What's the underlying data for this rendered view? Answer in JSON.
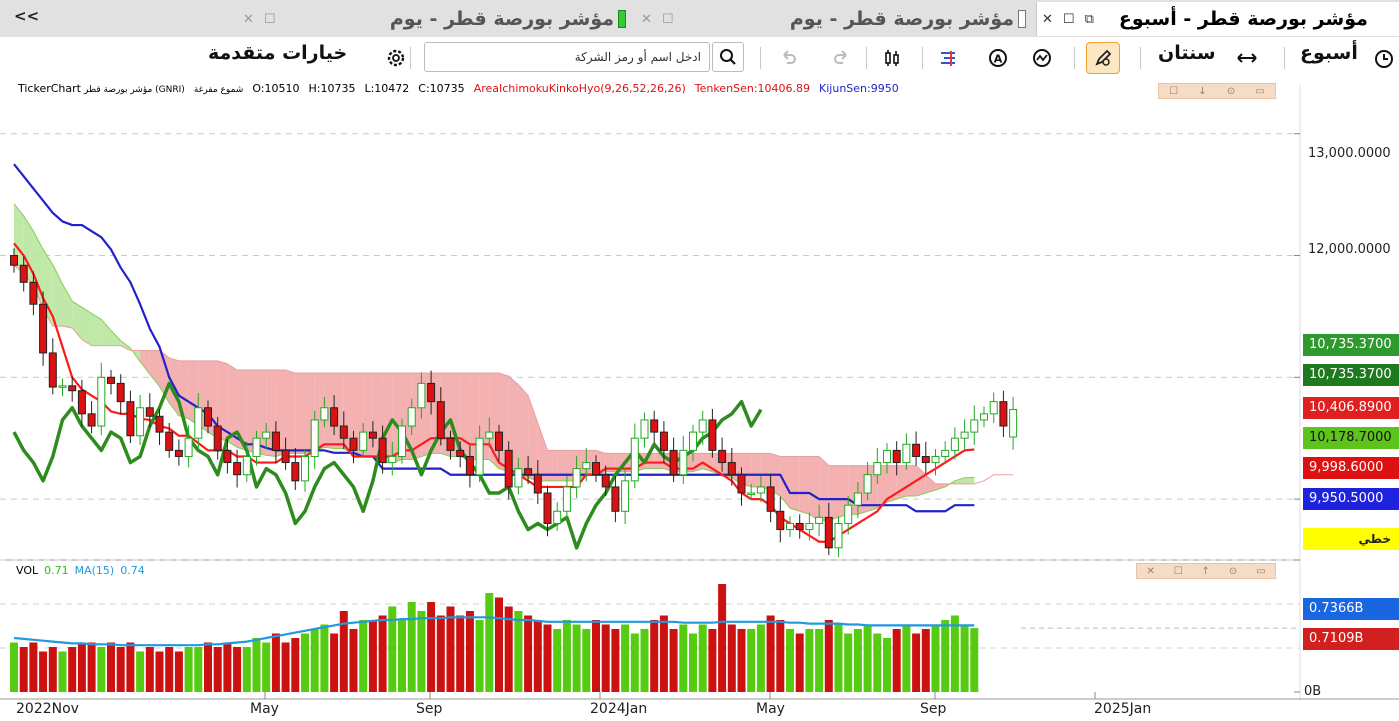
{
  "tabs": [
    {
      "title": "مؤشر بورصة قطر - يوم",
      "marker_color": "#33cc33",
      "active": false
    },
    {
      "title": "مؤشر بورصة قطر - يوم",
      "marker_color": "#ffffff",
      "active": false
    },
    {
      "title": "مؤشر بورصة قطر - أسبوع",
      "active": true
    }
  ],
  "tab_scroll": "<<",
  "toolbar": {
    "period": "أسبوع",
    "range": "سنتان",
    "search_placeholder": "ادخل اسم أو رمز الشركة",
    "advanced_options": "خيارات متقدمة"
  },
  "infobar": {
    "app": "TickerChart",
    "symbol": "مؤشر بورصة قطر (GNRI)",
    "chart_style": "شموع مفرغة",
    "open": "O:10510",
    "high": "H:10735",
    "low": "L:10472",
    "close": "C:10735",
    "indicator": "AreaIchimokuKinkoHyo(9,26,52,26,26)",
    "tenkan": "TenkenSen:10406.89",
    "kijun": "KijunSen:9950"
  },
  "price_axis": {
    "ticks": [
      "13,000.0000",
      "12,000.0000"
    ],
    "labels": [
      {
        "text": "10,735.3700",
        "color": "#2e9a2e"
      },
      {
        "text": "10,735.3700",
        "color": "#1f7a1f"
      },
      {
        "text": "10,406.8900",
        "color": "#e02020"
      },
      {
        "text": "10,178.7000",
        "color": "#5ec31a"
      },
      {
        "text": "9,998.6000",
        "color": "#dd1111"
      },
      {
        "text": "9,950.5000",
        "color": "#1f22dd"
      },
      {
        "text": "خطي",
        "color": "#ffff00"
      }
    ]
  },
  "volume_pane": {
    "label": "VOL",
    "value": "0.71",
    "ma_label": "MA(15)",
    "ma_value": "0.74",
    "axis_labels": [
      {
        "text": "0.7366B",
        "color": "#1a66e0"
      },
      {
        "text": "0.7109B",
        "color": "#d22020"
      }
    ],
    "zero_label": "0B"
  },
  "time_axis": [
    "2022Nov",
    "May",
    "Sep",
    "2024Jan",
    "May",
    "Sep",
    "2025Jan"
  ],
  "colors": {
    "up": "#22aa22",
    "down": "#dd1111",
    "tenkan": "#ff1a1a",
    "kijun": "#2222cc",
    "chikou": "#2e8b1e",
    "cloud_bear": "#f2a8a8",
    "cloud_bull": "#b8e6a0",
    "volume_up": "#55cc11",
    "volume_down": "#cc1111",
    "volume_ma": "#2299dd"
  },
  "chart_data": {
    "type": "candlestick",
    "title": "مؤشر بورصة قطر - أسبوع",
    "x_range": [
      "2022Nov",
      "2025Jan"
    ],
    "y_range": [
      9500,
      13400
    ],
    "last_candle": {
      "open": 10510,
      "high": 10735,
      "low": 10472,
      "close": 10735
    },
    "close_series": [
      11920,
      11780,
      11600,
      11200,
      10920,
      10930,
      10890,
      10700,
      10600,
      11000,
      10950,
      10800,
      10520,
      10750,
      10680,
      10550,
      10400,
      10350,
      10500,
      10750,
      10600,
      10400,
      10300,
      10200,
      10350,
      10500,
      10550,
      10400,
      10300,
      10150,
      10350,
      10650,
      10750,
      10600,
      10500,
      10400,
      10550,
      10500,
      10300,
      10350,
      10600,
      10750,
      10950,
      10800,
      10500,
      10400,
      10350,
      10200,
      10500,
      10550,
      10400,
      10100,
      10250,
      10200,
      10050,
      9800,
      9900,
      10100,
      10250,
      10300,
      10200,
      10100,
      9900,
      10150,
      10500,
      10650,
      10550,
      10400,
      10200,
      10400,
      10550,
      10650,
      10400,
      10300,
      10200,
      10050,
      10050,
      10100,
      9900,
      9750,
      9800,
      9750,
      9800,
      9850,
      9600,
      9800,
      9950,
      10050,
      10200,
      10300,
      10400,
      10300,
      10450,
      10350,
      10300,
      10350,
      10400,
      10500,
      10550,
      10650,
      10700,
      10800,
      10600,
      10735
    ],
    "tenkan_series": [
      12100,
      12000,
      11850,
      11650,
      11500,
      11250,
      11000,
      10900,
      10850,
      10800,
      10720,
      10700,
      10700,
      10660,
      10650,
      10600,
      10580,
      10520,
      10520,
      10460,
      10400,
      10400,
      10400,
      10350,
      10350,
      10300,
      10300,
      10300,
      10350,
      10350,
      10350,
      10400,
      10450,
      10450,
      10450,
      10350,
      10350,
      10350,
      10350,
      10350,
      10400,
      10400,
      10450,
      10500,
      10500,
      10500,
      10500,
      10450,
      10450,
      10450,
      10300,
      10250,
      10200,
      10150,
      10100,
      10100,
      10100,
      10100,
      10100,
      10200,
      10200,
      10250,
      10250,
      10250,
      10250,
      10300,
      10300,
      10300,
      10250,
      10250,
      10250,
      10300,
      10250,
      10200,
      10150,
      10050,
      10000,
      10000,
      9950,
      9850,
      9800,
      9750,
      9700,
      9650,
      9650,
      9700,
      9750,
      9800,
      9850,
      9900,
      10000,
      10050,
      10100,
      10150,
      10200,
      10250,
      10300,
      10350,
      10400,
      10407
    ],
    "kijun_series": [
      12750,
      12650,
      12550,
      12450,
      12350,
      12280,
      12250,
      12250,
      12200,
      12150,
      12050,
      11900,
      11780,
      11600,
      11400,
      11250,
      11000,
      10850,
      10800,
      10750,
      10700,
      10600,
      10550,
      10500,
      10450,
      10450,
      10420,
      10400,
      10400,
      10400,
      10400,
      10400,
      10400,
      10380,
      10380,
      10380,
      10350,
      10350,
      10250,
      10250,
      10250,
      10250,
      10250,
      10250,
      10250,
      10200,
      10200,
      10200,
      10200,
      10200,
      10200,
      10200,
      10200,
      10200,
      10200,
      10200,
      10200,
      10200,
      10200,
      10200,
      10200,
      10200,
      10200,
      10200,
      10200,
      10200,
      10200,
      10200,
      10200,
      10200,
      10200,
      10200,
      10200,
      10200,
      10200,
      10200,
      10200,
      10200,
      10200,
      10200,
      10050,
      10050,
      10050,
      10000,
      10000,
      10000,
      10000,
      9950,
      9950,
      9950,
      9950,
      9950,
      9950,
      9900,
      9900,
      9900,
      9900,
      9950,
      9950,
      9950
    ],
    "volume_series": [
      0.55,
      0.5,
      0.55,
      0.45,
      0.5,
      0.45,
      0.5,
      0.55,
      0.55,
      0.5,
      0.55,
      0.5,
      0.55,
      0.45,
      0.5,
      0.45,
      0.5,
      0.45,
      0.5,
      0.5,
      0.55,
      0.5,
      0.55,
      0.5,
      0.5,
      0.6,
      0.55,
      0.65,
      0.55,
      0.6,
      0.65,
      0.7,
      0.75,
      0.65,
      0.9,
      0.7,
      0.8,
      0.8,
      0.85,
      0.95,
      0.8,
      1.0,
      0.9,
      1.0,
      0.85,
      0.95,
      0.85,
      0.9,
      0.8,
      1.1,
      1.05,
      0.95,
      0.9,
      0.85,
      0.8,
      0.75,
      0.7,
      0.8,
      0.75,
      0.7,
      0.8,
      0.75,
      0.7,
      0.75,
      0.65,
      0.7,
      0.8,
      0.85,
      0.7,
      0.75,
      0.65,
      0.75,
      0.7,
      1.2,
      0.75,
      0.7,
      0.7,
      0.75,
      0.85,
      0.8,
      0.7,
      0.65,
      0.7,
      0.7,
      0.8,
      0.75,
      0.65,
      0.7,
      0.75,
      0.65,
      0.6,
      0.7,
      0.75,
      0.65,
      0.7,
      0.75,
      0.8,
      0.85,
      0.75,
      0.71
    ],
    "volume_ma_series": [
      0.6,
      0.59,
      0.58,
      0.57,
      0.56,
      0.55,
      0.54,
      0.54,
      0.53,
      0.53,
      0.53,
      0.52,
      0.52,
      0.52,
      0.52,
      0.52,
      0.52,
      0.52,
      0.52,
      0.52,
      0.53,
      0.53,
      0.54,
      0.55,
      0.56,
      0.58,
      0.6,
      0.62,
      0.64,
      0.66,
      0.68,
      0.7,
      0.72,
      0.74,
      0.76,
      0.77,
      0.78,
      0.79,
      0.8,
      0.8,
      0.81,
      0.81,
      0.82,
      0.82,
      0.82,
      0.83,
      0.83,
      0.83,
      0.83,
      0.83,
      0.82,
      0.81,
      0.8,
      0.8,
      0.79,
      0.78,
      0.78,
      0.78,
      0.78,
      0.78,
      0.78,
      0.78,
      0.78,
      0.78,
      0.78,
      0.78,
      0.78,
      0.78,
      0.78,
      0.77,
      0.77,
      0.77,
      0.77,
      0.78,
      0.78,
      0.78,
      0.78,
      0.78,
      0.78,
      0.78,
      0.77,
      0.77,
      0.76,
      0.76,
      0.76,
      0.76,
      0.75,
      0.75,
      0.74,
      0.74,
      0.74,
      0.74,
      0.74,
      0.74,
      0.74,
      0.74,
      0.74,
      0.74,
      0.74,
      0.74
    ],
    "volume_y_range": [
      0,
      1.3
    ]
  }
}
